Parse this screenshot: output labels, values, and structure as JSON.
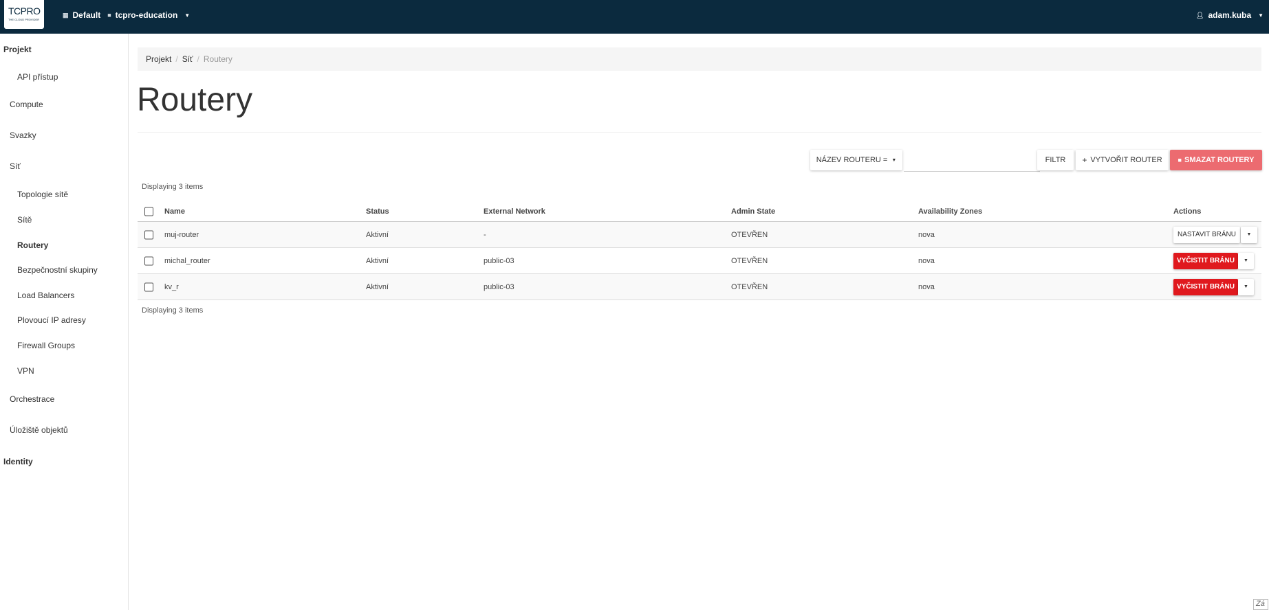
{
  "header": {
    "logo_text": "TCPRO",
    "logo_subtext": "THE CLOUD PROVIDER",
    "domain": "Default",
    "project": "tcpro-education",
    "user": "adam.kuba"
  },
  "sidebar": {
    "project_label": "Projekt",
    "api_access": "API přístup",
    "compute": "Compute",
    "volumes": "Svazky",
    "network": "Síť",
    "network_items": [
      "Topologie sítě",
      "Sítě",
      "Routery",
      "Bezpečnostní skupiny",
      "Load Balancers",
      "Plovoucí IP adresy",
      "Firewall Groups",
      "VPN"
    ],
    "orchestration": "Orchestrace",
    "object_store": "Úložiště objektů",
    "identity": "Identity"
  },
  "breadcrumb": [
    "Projekt",
    "Síť",
    "Routery"
  ],
  "page_title": "Routery",
  "toolbar": {
    "filter_field": "NÁZEV ROUTERU =",
    "filter_value": "",
    "filter_button": "FILTR",
    "create_button": "VYTVOŘIT ROUTER",
    "delete_button": "SMAZAT ROUTERY"
  },
  "table": {
    "count_text": "Displaying 3 items",
    "columns": [
      "Name",
      "Status",
      "External Network",
      "Admin State",
      "Availability Zones",
      "Actions"
    ],
    "rows": [
      {
        "name": "muj-router",
        "status": "Aktivní",
        "external_network": "-",
        "admin_state": "OTEVŘEN",
        "availability_zones": "nova",
        "action": "NASTAVIT BRÁNU",
        "action_style": "default"
      },
      {
        "name": "michal_router",
        "status": "Aktivní",
        "external_network": "public-03",
        "admin_state": "OTEVŘEN",
        "availability_zones": "nova",
        "action": "VYČISTIT BRÁNU",
        "action_style": "danger"
      },
      {
        "name": "kv_r",
        "status": "Aktivní",
        "external_network": "public-03",
        "admin_state": "OTEVŘEN",
        "availability_zones": "nova",
        "action": "VYČISTIT BRÁNU",
        "action_style": "danger"
      }
    ]
  },
  "corner_text": "Zá"
}
